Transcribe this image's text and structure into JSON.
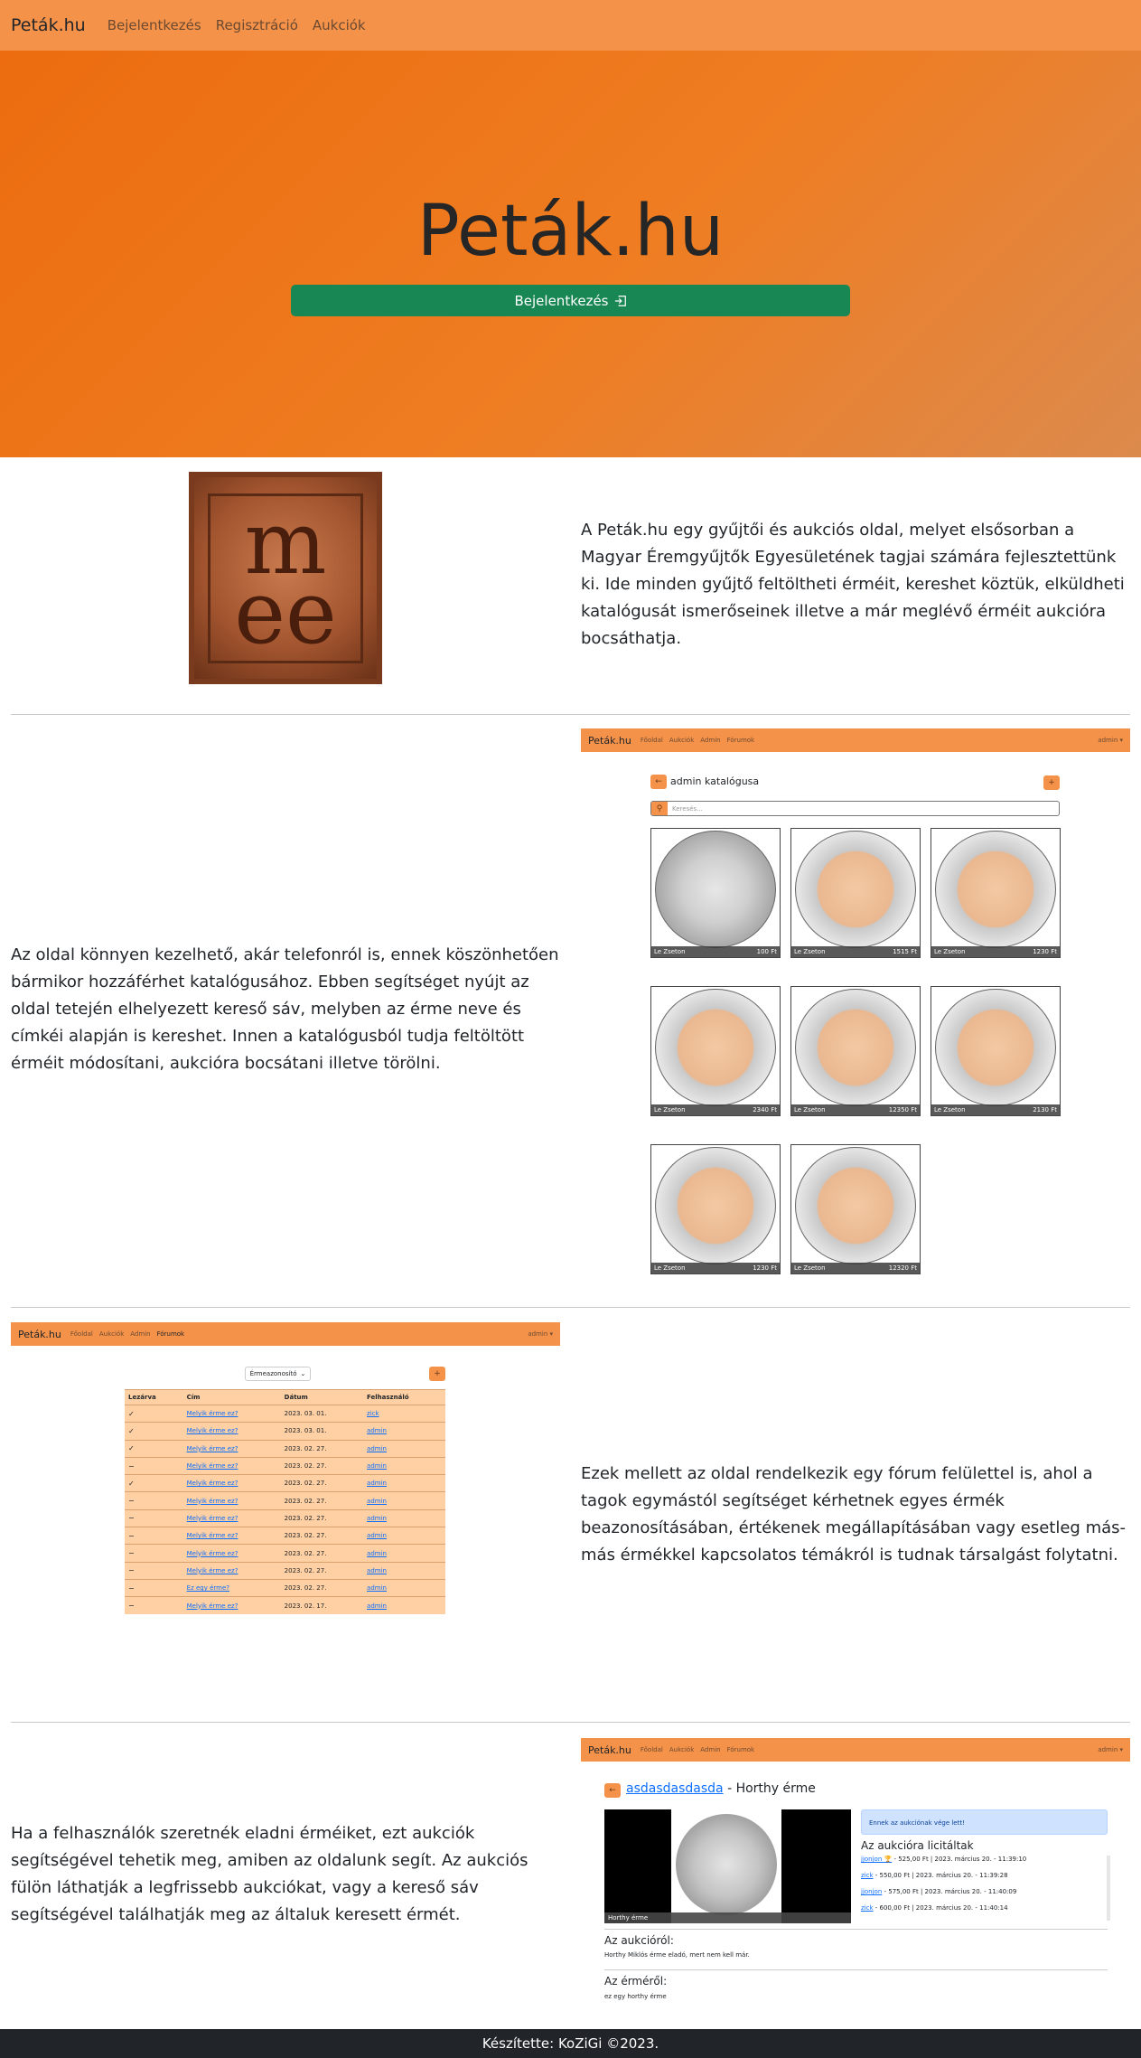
{
  "nav": {
    "brand": "Peták.hu",
    "links": [
      "Bejelentkezés",
      "Regisztráció",
      "Aukciók"
    ]
  },
  "hero": {
    "title": "Peták.hu",
    "button": "Bejelentkezés"
  },
  "intro": {
    "text": "A Peták.hu egy gyűjtői és aukciós oldal, melyet elsősorban a Magyar Éremgyűjtők Egyesületének tagjai számára fejlesztettünk ki. Ide minden gyűjtő feltöltheti érméit, kereshet köztük, elküldheti katalógusát ismerőseinek illetve a már meglévő érméit aukcióra bocsáthatja."
  },
  "catalog_section": {
    "text": "Az oldal könnyen kezelhető, akár telefonról is, ennek köszönhetően bármikor hozzáférhet katalógusához. Ebben segítséget nyújt az oldal tetején elhelyezett kereső sáv, melyben az érme neve és címkéi alapján is kereshet. Innen a katalógusból tudja feltöltött érméit módosítani, aukcióra bocsátani illetve törölni."
  },
  "mini_nav": {
    "brand": "Peták.hu",
    "links": [
      "Főoldal",
      "Aukciók",
      "Admin",
      "Fórumok"
    ],
    "user": "admin ▾"
  },
  "catalog_shot": {
    "title": "admin katalógusa",
    "search_placeholder": "Keresés...",
    "coins": [
      {
        "name": "Le Zseton",
        "price": "100 Ft",
        "style": "silver"
      },
      {
        "name": "Le Zseton",
        "price": "1515 Ft",
        "style": "bimetal"
      },
      {
        "name": "Le Zseton",
        "price": "1230 Ft",
        "style": "bimetal"
      },
      {
        "name": "Le Zseton",
        "price": "2340 Ft",
        "style": "bimetal"
      },
      {
        "name": "Le Zseton",
        "price": "12350 Ft",
        "style": "bimetal"
      },
      {
        "name": "Le Zseton",
        "price": "2130 Ft",
        "style": "bimetal"
      },
      {
        "name": "Le Zseton",
        "price": "1230 Ft",
        "style": "bimetal"
      },
      {
        "name": "Le Zseton",
        "price": "12320 Ft",
        "style": "bimetal"
      }
    ]
  },
  "forum_section": {
    "text": "Ezek mellett az oldal rendelkezik egy fórum felülettel is, ahol a tagok egymástól segítséget kérhetnek egyes érmék beazonosításában, értékenek megállapításában vagy esetleg más-más érmékkel kapcsolatos témákról is tudnak társalgást folytatni."
  },
  "forum_shot": {
    "dropdown": "Érmeazonosító",
    "headers": [
      "Lezárva",
      "Cím",
      "Dátum",
      "Felhasználó"
    ],
    "rows": [
      {
        "closed": "✓",
        "title": "Melyik érme ez?",
        "date": "2023. 03. 01.",
        "user": "zick"
      },
      {
        "closed": "✓",
        "title": "Melyik érme ez?",
        "date": "2023. 03. 01.",
        "user": "admin"
      },
      {
        "closed": "✓",
        "title": "Melyik érme ez?",
        "date": "2023. 02. 27.",
        "user": "admin"
      },
      {
        "closed": "−",
        "title": "Melyik érme ez?",
        "date": "2023. 02. 27.",
        "user": "admin"
      },
      {
        "closed": "✓",
        "title": "Melyik érme ez?",
        "date": "2023. 02. 27.",
        "user": "admin"
      },
      {
        "closed": "−",
        "title": "Melyik érme ez?",
        "date": "2023. 02. 27.",
        "user": "admin"
      },
      {
        "closed": "−",
        "title": "Melyik érme ez?",
        "date": "2023. 02. 27.",
        "user": "admin"
      },
      {
        "closed": "−",
        "title": "Melyik érme ez?",
        "date": "2023. 02. 27.",
        "user": "admin"
      },
      {
        "closed": "−",
        "title": "Melyik érme ez?",
        "date": "2023. 02. 27.",
        "user": "admin"
      },
      {
        "closed": "−",
        "title": "Melyik érme ez?",
        "date": "2023. 02. 27.",
        "user": "admin"
      },
      {
        "closed": "−",
        "title": "Ez egy érme?",
        "date": "2023. 02. 27.",
        "user": "admin"
      },
      {
        "closed": "−",
        "title": "Melyik érme ez?",
        "date": "2023. 02. 17.",
        "user": "admin"
      }
    ]
  },
  "auction_section": {
    "text": "Ha a felhasználók szeretnék eladni érméiket, ezt aukciók segítségével tehetik meg, amiben az oldalunk segít. Az aukciós fülön láthatják a legfrissebb aukciókat, vagy a kereső sáv segítségével találhatják meg az általuk keresett érmét."
  },
  "auction_shot": {
    "seller": "asdasdasdasda",
    "title_suffix": " - Horthy érme",
    "image_caption": "Horthy érme",
    "alert": "Ennek az aukciónak vége lett!",
    "bids_title": "Az aukcióra licitáltak",
    "bids": [
      {
        "user": "jjonjon 🏆",
        "text": " - 525,00 Ft | 2023. március 20. - 11:39:10"
      },
      {
        "user": "zick",
        "text": " - 550,00 Ft | 2023. március 20. - 11:39:28"
      },
      {
        "user": "jjonjon",
        "text": " - 575,00 Ft | 2023. március 20. - 11:40:09"
      },
      {
        "user": "zick",
        "text": " - 600,00 Ft | 2023. március 20. - 11:40:14"
      }
    ],
    "about_auction_title": "Az aukcióról:",
    "about_auction_text": "Horthy Miklós érme eladó, mert nem kell már.",
    "about_coin_title": "Az érméről:",
    "about_coin_text": "ez egy horthy érme"
  },
  "footer": {
    "text": "Készítette: KoZiGi ©2023."
  }
}
